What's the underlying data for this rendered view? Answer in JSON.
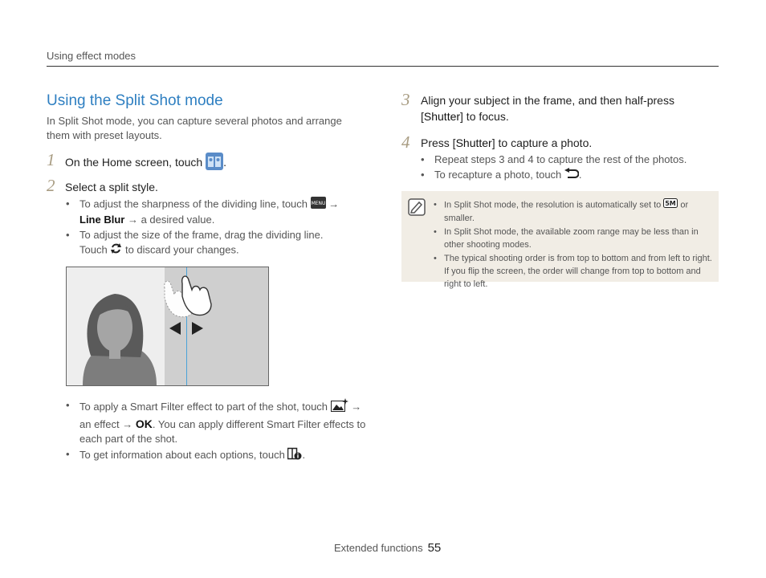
{
  "header": {
    "section": "Using effect modes"
  },
  "title": "Using the Split Shot mode",
  "intro": "In Split Shot mode, you can capture several photos and arrange them with preset layouts.",
  "steps": [
    {
      "num": "1",
      "text_before": "On the Home screen, touch",
      "text_after": "."
    },
    {
      "num": "2",
      "text": "Select a split style."
    },
    {
      "num": "3",
      "text_a": "Align your subject in the frame, and then half-press [",
      "bold": "Shutter",
      "text_b": "] to focus."
    },
    {
      "num": "4",
      "text_a": "Press [",
      "bold": "Shutter",
      "text_b": "] to capture a photo."
    }
  ],
  "step2_bullets": {
    "b1_a": "To adjust the sharpness of the dividing line, touch",
    "b1_arrow1": "→",
    "b1_bold": "Line Blur",
    "b1_b": "→ a desired value.",
    "b2_a": "To adjust the size of the frame, drag the dividing line.",
    "b2_b": "Touch",
    "b2_c": "to discard your changes.",
    "b3_a": "To apply a Smart Filter effect to part of the shot, touch",
    "b3_arrow": "→",
    "b3_b": "an effect →",
    "b3_ok": "OK",
    "b3_c": ". You can apply different Smart Filter effects to each part of the shot.",
    "b4_a": "To get information about each options, touch",
    "b4_b": "."
  },
  "step4_bullets": {
    "b1": "Repeat steps 3 and 4 to capture the rest of the photos.",
    "b2_a": "To recapture a photo, touch",
    "b2_b": "."
  },
  "icons": {
    "menu_icon_label": "MENU",
    "resolution_label": "5M"
  },
  "notes": {
    "n1_a": "In Split Shot mode, the resolution is automatically set to",
    "n1_b": "or smaller.",
    "n2": "In Split Shot mode, the available zoom range may be less than in other shooting modes.",
    "n3": "The typical shooting order is from top to bottom and from left to right. If you flip the screen, the order will change from top to bottom and right to left."
  },
  "footer": {
    "label": "Extended functions",
    "page": "55"
  },
  "colors": {
    "title": "#2e7fc1",
    "step_number": "#a89c82",
    "note_bg": "#f1ede5",
    "divider_line": "#4aa3d8"
  }
}
